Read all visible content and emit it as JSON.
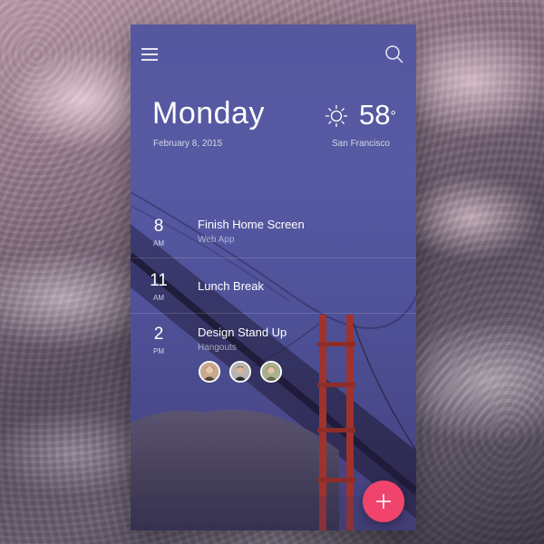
{
  "header": {
    "day": "Monday",
    "date": "February 8, 2015"
  },
  "weather": {
    "temperature": "58",
    "degree_symbol": "°",
    "city": "San Francisco",
    "icon": "sun-icon"
  },
  "events": [
    {
      "hour": "8",
      "ampm": "AM",
      "title": "Finish Home Screen",
      "subtitle": "Web App"
    },
    {
      "hour": "11",
      "ampm": "AM",
      "title": "Lunch Break",
      "subtitle": ""
    },
    {
      "hour": "2",
      "ampm": "PM",
      "title": "Design Stand Up",
      "subtitle": "Hangouts"
    }
  ],
  "icons": {
    "menu": "menu-icon",
    "search": "search-icon",
    "add": "plus-icon"
  },
  "colors": {
    "card_top": "#55589f",
    "card_bottom": "#433f7c",
    "fab": "#f0446c",
    "text": "#ffffff"
  }
}
